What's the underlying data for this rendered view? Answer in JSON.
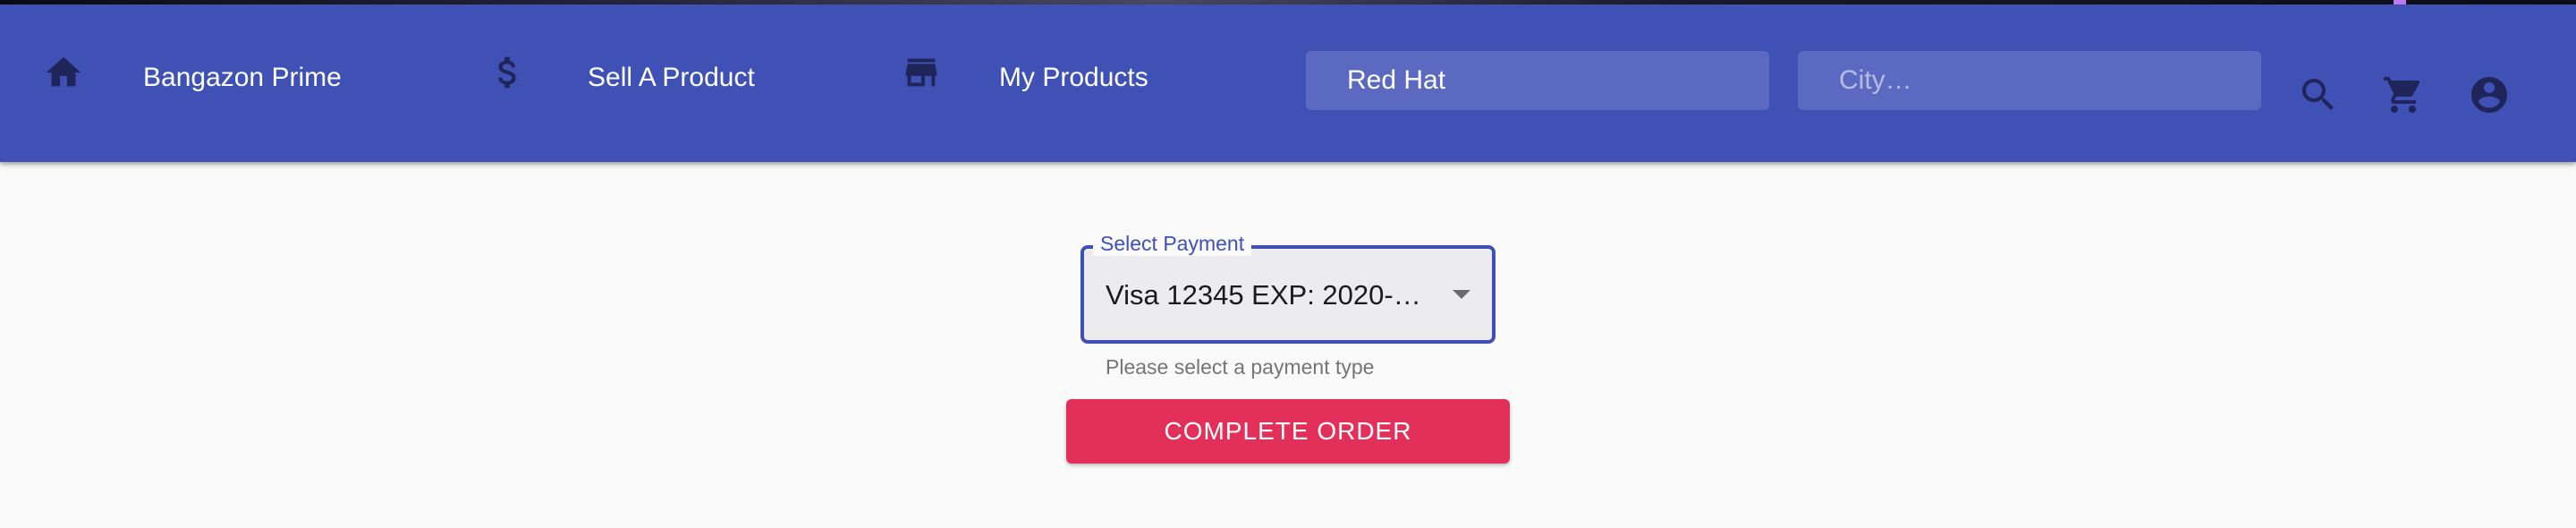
{
  "colors": {
    "appbar": "#3f51b5",
    "primary_button": "#e3305a",
    "select_focus": "#3f51b5",
    "icon": "#1f2459"
  },
  "nav": [
    {
      "icon": "home-icon",
      "label": "Bangazon Prime"
    },
    {
      "icon": "dollar-icon",
      "label": "Sell A Product"
    },
    {
      "icon": "store-icon",
      "label": "My Products"
    }
  ],
  "search": {
    "product_value": "Red Hat",
    "city_placeholder": "City…"
  },
  "actions": {
    "search_icon": "search-icon",
    "cart_icon": "cart-icon",
    "account_icon": "account-icon"
  },
  "payment": {
    "label": "Select Payment",
    "selected": "Visa 12345 EXP: 2020-…",
    "helper": "Please select a payment type"
  },
  "order": {
    "button_label": "COMPLETE ORDER"
  }
}
